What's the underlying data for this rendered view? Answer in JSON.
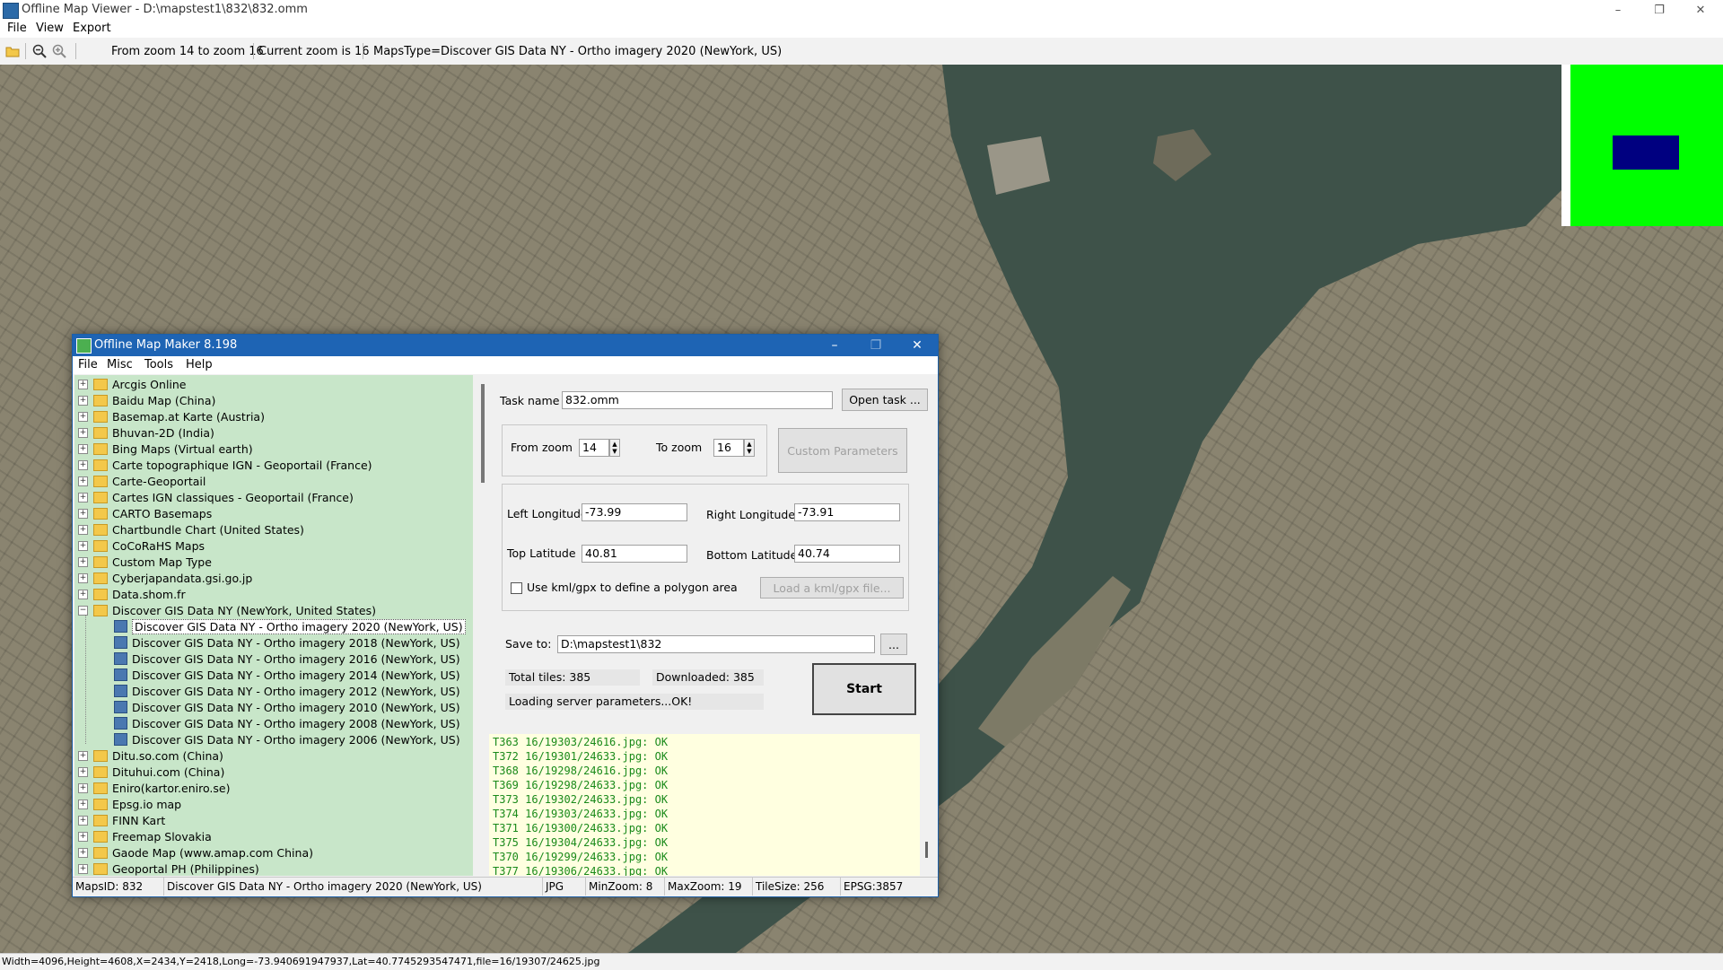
{
  "window": {
    "title": "Offline Map Viewer - D:\\mapstest1\\832\\832.omm",
    "controls": [
      "–",
      "❐",
      "✕"
    ]
  },
  "menu": [
    "File",
    "View",
    "Export"
  ],
  "toolbar": {
    "zoom_range": "From zoom 14 to zoom 16",
    "current_zoom": "Current zoom is 16",
    "maps_type": "MapsType=Discover GIS Data NY - Ortho imagery 2020 (NewYork, US)"
  },
  "overview": {
    "background": "#00ff00",
    "viewport": "#000080"
  },
  "status": "Width=4096,Height=4608,X=2434,Y=2418,Long=-73.940691947937,Lat=40.7745293547471,file=16/19307/24625.jpg",
  "dialog": {
    "title": "Offline Map Maker 8.198",
    "menu": [
      "File",
      "Misc",
      "Tools",
      "Help"
    ],
    "tree": [
      {
        "label": "Arcgis Online",
        "level": 0,
        "type": "folder",
        "expander": "+"
      },
      {
        "label": "Baidu Map (China)",
        "level": 0,
        "type": "folder",
        "expander": "+"
      },
      {
        "label": "Basemap.at Karte (Austria)",
        "level": 0,
        "type": "folder",
        "expander": "+"
      },
      {
        "label": "Bhuvan-2D (India)",
        "level": 0,
        "type": "folder",
        "expander": "+"
      },
      {
        "label": "Bing Maps (Virtual earth)",
        "level": 0,
        "type": "folder",
        "expander": "+"
      },
      {
        "label": "Carte topographique IGN - Geoportail (France)",
        "level": 0,
        "type": "folder",
        "expander": "+"
      },
      {
        "label": "Carte-Geoportail",
        "level": 0,
        "type": "folder",
        "expander": "+"
      },
      {
        "label": "Cartes IGN classiques - Geoportail (France)",
        "level": 0,
        "type": "folder",
        "expander": "+"
      },
      {
        "label": "CARTO Basemaps",
        "level": 0,
        "type": "folder",
        "expander": "+"
      },
      {
        "label": "Chartbundle Chart (United States)",
        "level": 0,
        "type": "folder",
        "expander": "+"
      },
      {
        "label": "CoCoRaHS Maps",
        "level": 0,
        "type": "folder",
        "expander": "+"
      },
      {
        "label": "Custom Map Type",
        "level": 0,
        "type": "folder",
        "expander": "+"
      },
      {
        "label": "Cyberjapandata.gsi.go.jp",
        "level": 0,
        "type": "folder",
        "expander": "+"
      },
      {
        "label": "Data.shom.fr",
        "level": 0,
        "type": "folder",
        "expander": "+"
      },
      {
        "label": "Discover GIS Data NY (NewYork, United States)",
        "level": 0,
        "type": "folder",
        "expander": "−"
      },
      {
        "label": "Discover GIS Data NY - Ortho imagery 2020 (NewYork, US)",
        "level": 1,
        "type": "map",
        "selected": true
      },
      {
        "label": "Discover GIS Data NY - Ortho imagery 2018 (NewYork, US)",
        "level": 1,
        "type": "map"
      },
      {
        "label": "Discover GIS Data NY - Ortho imagery 2016 (NewYork, US)",
        "level": 1,
        "type": "map"
      },
      {
        "label": "Discover GIS Data NY - Ortho imagery 2014 (NewYork, US)",
        "level": 1,
        "type": "map"
      },
      {
        "label": "Discover GIS Data NY - Ortho imagery 2012 (NewYork, US)",
        "level": 1,
        "type": "map"
      },
      {
        "label": "Discover GIS Data NY - Ortho imagery 2010 (NewYork, US)",
        "level": 1,
        "type": "map"
      },
      {
        "label": "Discover GIS Data NY - Ortho imagery 2008 (NewYork, US)",
        "level": 1,
        "type": "map"
      },
      {
        "label": "Discover GIS Data NY - Ortho imagery 2006 (NewYork, US)",
        "level": 1,
        "type": "map"
      },
      {
        "label": "Ditu.so.com (China)",
        "level": 0,
        "type": "folder",
        "expander": "+"
      },
      {
        "label": "Dituhui.com (China)",
        "level": 0,
        "type": "folder",
        "expander": "+"
      },
      {
        "label": "Eniro(kartor.eniro.se)",
        "level": 0,
        "type": "folder",
        "expander": "+"
      },
      {
        "label": "Epsg.io map",
        "level": 0,
        "type": "folder",
        "expander": "+"
      },
      {
        "label": "FINN Kart",
        "level": 0,
        "type": "folder",
        "expander": "+"
      },
      {
        "label": "Freemap Slovakia",
        "level": 0,
        "type": "folder",
        "expander": "+"
      },
      {
        "label": "Gaode Map (www.amap.com China)",
        "level": 0,
        "type": "folder",
        "expander": "+"
      },
      {
        "label": "Geoportal PH (Philippines)",
        "level": 0,
        "type": "folder",
        "expander": "+"
      }
    ],
    "task_label": "Task name",
    "task_value": "832.omm",
    "open_task": "Open task ...",
    "from_zoom_label": "From zoom",
    "from_zoom": "14",
    "to_zoom_label": "To zoom",
    "to_zoom": "16",
    "custom_params": "Custom Parameters",
    "left_lon_label": "Left Longitude",
    "left_lon": "-73.99",
    "right_lon_label": "Right Longitude",
    "right_lon": "-73.91",
    "top_lat_label": "Top Latitude",
    "top_lat": "40.81",
    "bottom_lat_label": "Bottom Latitude",
    "bottom_lat": "40.74",
    "kml_label": "Use kml/gpx to define a polygon area",
    "load_kml": "Load a kml/gpx file...",
    "save_label": "Save to:",
    "save_path": "D:\\mapstest1\\832",
    "browse": "...",
    "total_tiles": "Total tiles: 385",
    "downloaded": "Downloaded: 385",
    "loading": "Loading server parameters...OK!",
    "start": "Start",
    "log": [
      "T363 16/19303/24616.jpg: OK",
      "T372 16/19301/24633.jpg: OK",
      "T368 16/19298/24616.jpg: OK",
      "T369 16/19298/24633.jpg: OK",
      "T373 16/19302/24633.jpg: OK",
      "T374 16/19303/24633.jpg: OK",
      "T371 16/19300/24633.jpg: OK",
      "T375 16/19304/24633.jpg: OK",
      "T370 16/19299/24633.jpg: OK",
      "T377 16/19306/24633.jpg: OK"
    ],
    "status": {
      "maps_id": "MapsID: 832",
      "name": "Discover GIS Data NY - Ortho imagery 2020 (NewYork, US)",
      "format": "JPG",
      "min_zoom": "MinZoom: 8",
      "max_zoom": "MaxZoom: 19",
      "tile_size": "TileSize: 256",
      "epsg": "EPSG:3857"
    }
  }
}
